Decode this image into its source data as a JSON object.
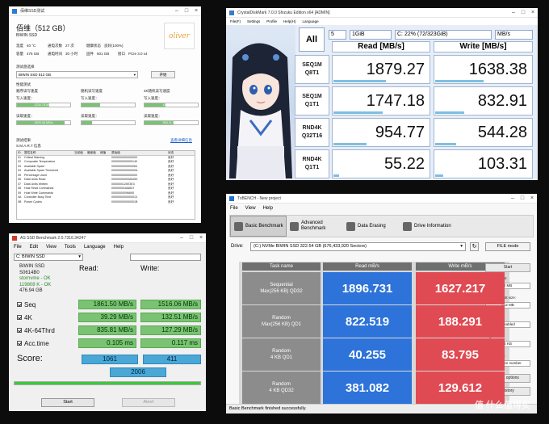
{
  "winA": {
    "title": "佰维SSD测试",
    "drive_name": "佰维（512 GB）",
    "model": "BIWIN SSD",
    "brand_logo": "oliver",
    "info": {
      "temp_label": "温度",
      "temp": "40 °C",
      "power_on_label": "通电次数",
      "power_on": "27 次",
      "health_label": "健康状态",
      "health": "良好(100%)",
      "capacity_label": "容量",
      "capacity": "476 GB",
      "hours_label": "通电时间",
      "hours": "30 小时",
      "firmware_label": "固件",
      "firmware": "601 GB",
      "interface_label": "接口",
      "interface": "PCIe 3.0 x4"
    },
    "test_label": "测试盘选择",
    "select_value": "BIWIN SSD 512 GB",
    "start_button": "开始",
    "perf_label": "性能测试",
    "tests": [
      {
        "title": "顺序读写速度",
        "write_lbl": "写入速度：",
        "write": "1234.78 MB/s",
        "read_lbl": "读取速度：",
        "read": "1805.46 MB/s",
        "write_pct": 0.6,
        "read_pct": 0.9
      },
      {
        "title": "随机读写速度",
        "write_lbl": "写入速度：",
        "write": "129.51 MB/s",
        "read_lbl": "读取速度：",
        "read": "36.97 MB/s",
        "write_pct": 0.35,
        "read_pct": 0.2
      },
      {
        "title": "4K随机读写速度",
        "write_lbl": "写入速度：",
        "write": "166.39 MB/s",
        "read_lbl": "读取速度：",
        "read": "894.11 MB/s",
        "write_pct": 0.4,
        "read_pct": 0.55
      }
    ],
    "smart_label": "S.M.A.R.T 信息",
    "smart_caption": "测试结果",
    "smart_link": "查看详细信息",
    "smart_headers": [
      "ID",
      "属性名称",
      "当前值",
      "最差值",
      "阈值",
      "原始值",
      "状态"
    ],
    "smart_rows": [
      [
        "01",
        "Critical Warning",
        "",
        "",
        "",
        "0000000000000000",
        "良好"
      ],
      [
        "02",
        "Composite Temperature",
        "",
        "",
        "",
        "0000000000000140",
        "良好"
      ],
      [
        "03",
        "Available Spare",
        "",
        "",
        "",
        "0000000000000064",
        "良好"
      ],
      [
        "04",
        "Available Spare Threshold",
        "",
        "",
        "",
        "000000000000000A",
        "良好"
      ],
      [
        "05",
        "Percentage Used",
        "",
        "",
        "",
        "0000000000000000",
        "良好"
      ],
      [
        "06",
        "Data Units Read",
        "",
        "",
        "",
        "00000000000A5260",
        "良好"
      ],
      [
        "07",
        "Data Units Written",
        "",
        "",
        "",
        "0000000120E3E3",
        "良好"
      ],
      [
        "08",
        "Host Read Commands",
        "",
        "",
        "",
        "000000004A6837",
        "良好"
      ],
      [
        "09",
        "Host Write Commands",
        "",
        "",
        "",
        "00000000096690",
        "良好"
      ],
      [
        "0A",
        "Controller Busy Time",
        "",
        "",
        "",
        "0000000000000013",
        "良好"
      ],
      [
        "0B",
        "Power Cycles",
        "",
        "",
        "",
        "000000000000001B",
        "良好"
      ]
    ]
  },
  "winB": {
    "title": "CrystalDiskMark 7.0.0 Shizuku Edition x64 [ADMIN]",
    "menu": [
      "File(F)",
      "Settings",
      "Profile",
      "Help(H)",
      "Language"
    ],
    "all_button": "All",
    "count": "5",
    "size": "1GiB",
    "drive": "C: 22% (72/323GiB)",
    "unit": "MB/s",
    "read_header": "Read [MB/s]",
    "write_header": "Write [MB/s]",
    "rows": [
      {
        "l1": "SEQ1M",
        "l2": "Q8T1",
        "read": "1879.27",
        "write": "1638.38",
        "read_pct": 0.55,
        "write_pct": 0.5
      },
      {
        "l1": "SEQ1M",
        "l2": "Q1T1",
        "read": "1747.18",
        "write": "832.91",
        "read_pct": 0.52,
        "write_pct": 0.3
      },
      {
        "l1": "RND4K",
        "l2": "Q32T16",
        "read": "954.77",
        "write": "544.28",
        "read_pct": 0.35,
        "write_pct": 0.22
      },
      {
        "l1": "RND4K",
        "l2": "Q1T1",
        "read": "55.22",
        "write": "103.31",
        "read_pct": 0.06,
        "write_pct": 0.08
      }
    ]
  },
  "winC": {
    "title": "AS SSD Benchmark 2.0.7316.34247",
    "menu": [
      "File",
      "Edit",
      "View",
      "Tools",
      "Language",
      "Help"
    ],
    "drive_select": "C: BIWIN SSD",
    "drive_name": "BIWIN SSD",
    "firmware": "S0614B0",
    "driver": "stornvme - OK",
    "align": "119808 K - OK",
    "size": "476.94 GB",
    "read_header": "Read:",
    "write_header": "Write:",
    "tests": [
      {
        "label": "Seq",
        "read": "1861.50 MB/s",
        "write": "1516.06 MB/s"
      },
      {
        "label": "4K",
        "read": "39.29 MB/s",
        "write": "132.51 MB/s"
      },
      {
        "label": "4K-64Thrd",
        "read": "835.81 MB/s",
        "write": "127.29 MB/s"
      },
      {
        "label": "Acc.time",
        "read": "0.105 ms",
        "write": "0.117 ms"
      }
    ],
    "score_label": "Score:",
    "score_read": "1061",
    "score_write": "411",
    "score_total": "2006",
    "start_button": "Start",
    "abort_button": "Abort"
  },
  "winD": {
    "title": "TxBENCH - New project",
    "menu": [
      "File",
      "View",
      "Help"
    ],
    "tabs": [
      "Basic Benchmark",
      "Advanced Benchmark",
      "Data Erasing",
      "Drive Information"
    ],
    "drive_label": "Drive:",
    "drive_value": "(C:) NVMe BIWIN SSD  322.54 GB (676,433,920 Sectors)",
    "file_mode_button": "FILE mode",
    "col_task": "Task name",
    "col_read": "Read mB/s",
    "col_write": "Write mB/s",
    "rows": [
      {
        "l1": "Sequential",
        "l2": "Max(256 KB) QD32",
        "read": "1896.731",
        "write": "1627.217"
      },
      {
        "l1": "Random",
        "l2": "Max(256 KB) QD1",
        "read": "822.519",
        "write": "188.291"
      },
      {
        "l1": "Random",
        "l2": "4 KB QD1",
        "read": "40.255",
        "write": "83.795"
      },
      {
        "l1": "Random",
        "l2": "4 KB QD32",
        "read": "381.082",
        "write": "129.612"
      }
    ],
    "start_button": "Start",
    "start_pos_label": "Start position:",
    "start_pos": "0 MB",
    "meas_size_label": "Measurement size:",
    "meas_size": "512 MB",
    "prewrite_label": "Prewrite:",
    "prewrite": "Disabled",
    "align_label": "Alignment:",
    "align": "4 KB",
    "writing_label": "Writing data:",
    "writing": "Random number",
    "task_options_button": "Task options",
    "history_button": "History",
    "status": "Basic Benchmark finished successfully."
  },
  "watermark": "值 什么值得买"
}
